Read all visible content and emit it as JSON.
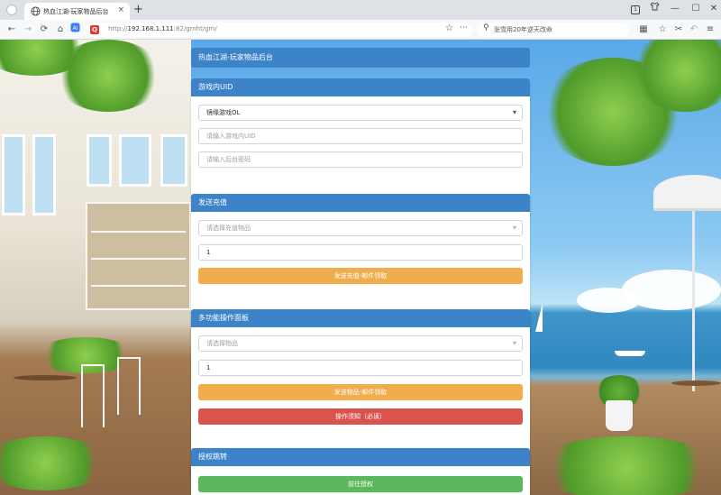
{
  "browser": {
    "tab_title": "热血江湖-玩家物品后台",
    "tab_close": "×",
    "new_tab": "+",
    "url_prefix": "http://",
    "url_host": "192.168.1.111",
    "url_path": ":82/gmht/gm/",
    "search_text": "张雪用20年逆天改命",
    "badge_count": "1",
    "more_dots": "···"
  },
  "icons": {
    "back": "←",
    "forward": "→",
    "reload": "⟳",
    "home": "⌂",
    "star": "☆",
    "search": "⚲",
    "minimize": "—",
    "maximize": "☐",
    "close": "✕",
    "grid": "▦",
    "bookmark": "☆",
    "cut": "✂",
    "undo": "↶",
    "menu": "≡",
    "caret": "▾"
  },
  "page": {
    "header_title": "热血江湖-玩家物品后台",
    "uid_panel": {
      "title": "游戏内UID",
      "game_select_value": "镜缘游戏OL",
      "uid_placeholder": "请输入游戏内UID",
      "password_placeholder": "请输入后台密码"
    },
    "recharge_panel": {
      "title": "发送充值",
      "item_placeholder": "请选择充值物品",
      "quantity_value": "1",
      "send_button": "发送充值-邮件领取"
    },
    "multi_panel": {
      "title": "多功能操作面板",
      "item_placeholder": "请选择物品",
      "quantity_value": "1",
      "send_button": "发送物品-邮件领取",
      "help_button": "操作须知（必读）"
    },
    "auth_panel": {
      "title": "授权跳转",
      "goto_button": "前往授权"
    }
  }
}
